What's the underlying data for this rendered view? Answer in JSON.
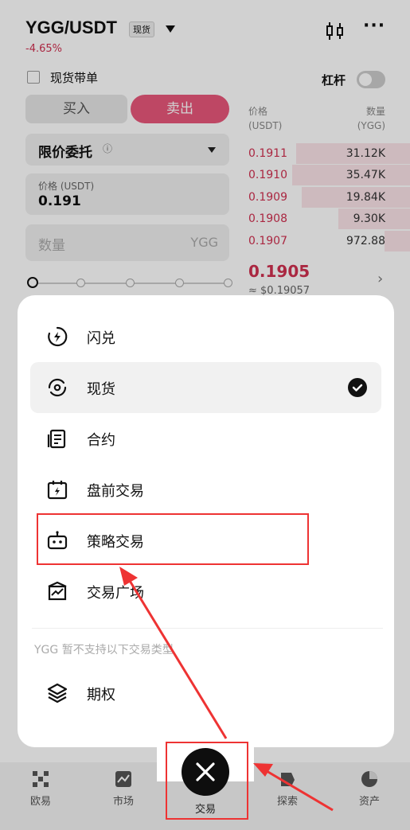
{
  "header": {
    "pair": "YGG/USDT",
    "market_tag": "现货",
    "change": "-4.65%",
    "copy_trade_label": "现货带单",
    "leverage_label": "杠杆"
  },
  "trade_form": {
    "buy_label": "买入",
    "sell_label": "卖出",
    "order_type": "限价委托",
    "price_label": "价格 (USDT)",
    "price_value": "0.191",
    "qty_placeholder": "数量",
    "qty_unit": "YGG"
  },
  "orderbook": {
    "price_header": "价格",
    "price_unit": "(USDT)",
    "qty_header": "数量",
    "qty_unit": "(YGG)",
    "asks": [
      {
        "price": "0.1911",
        "qty": "31.12K"
      },
      {
        "price": "0.1910",
        "qty": "35.47K"
      },
      {
        "price": "0.1909",
        "qty": "19.84K"
      },
      {
        "price": "0.1908",
        "qty": "9.30K"
      },
      {
        "price": "0.1907",
        "qty": "972.88"
      }
    ],
    "last_price": "0.1905",
    "usd_price": "≈ $0.19057"
  },
  "menu": {
    "items": [
      {
        "label": "闪兑",
        "icon": "flash-convert-icon"
      },
      {
        "label": "现货",
        "icon": "spot-icon",
        "selected": true
      },
      {
        "label": "合约",
        "icon": "contract-icon"
      },
      {
        "label": "盘前交易",
        "icon": "pre-market-icon"
      },
      {
        "label": "策略交易",
        "icon": "bot-icon"
      },
      {
        "label": "交易广场",
        "icon": "trading-square-icon"
      }
    ],
    "unsupported_note": "YGG 暂不支持以下交易类型",
    "unsupported_items": [
      {
        "label": "期权",
        "icon": "layers-icon"
      }
    ]
  },
  "bottom_nav": {
    "items": [
      {
        "label": "欧易",
        "icon": "okx-logo-icon"
      },
      {
        "label": "市场",
        "icon": "market-chart-icon"
      },
      {
        "label": "交易",
        "icon": "close-icon"
      },
      {
        "label": "探索",
        "icon": "explore-icon"
      },
      {
        "label": "资产",
        "icon": "assets-pie-icon"
      }
    ]
  },
  "colors": {
    "sell": "#e8577a",
    "down": "#d03050",
    "annotation": "#ee3333"
  }
}
